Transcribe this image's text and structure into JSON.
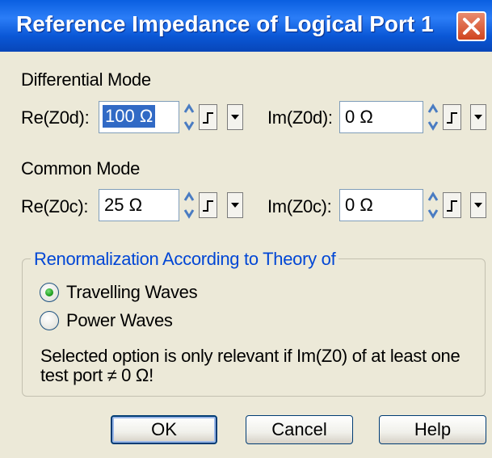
{
  "window": {
    "title": "Reference Impedance of Logical Port 1"
  },
  "differential": {
    "heading": "Differential Mode",
    "re_label": "Re(Z0d):",
    "re_value": "100 Ω",
    "im_label": "Im(Z0d):",
    "im_value": "0 Ω"
  },
  "common": {
    "heading": "Common Mode",
    "re_label": "Re(Z0c):",
    "re_value": "25 Ω",
    "im_label": "Im(Z0c):",
    "im_value": "0 Ω"
  },
  "renorm": {
    "title": "Renormalization According to Theory of",
    "options": [
      {
        "label": "Travelling Waves",
        "selected": true
      },
      {
        "label": "Power Waves",
        "selected": false
      }
    ],
    "note_line1": "Selected option is only relevant if Im(Z0) of at least one",
    "note_line2": "test port ≠ 0 Ω!"
  },
  "buttons": {
    "ok": "OK",
    "cancel": "Cancel",
    "help": "Help"
  },
  "icons": {
    "close": "close-icon",
    "spin": "spinner-arrows-icon",
    "step": "step-size-icon",
    "dropdown": "dropdown-arrow-icon"
  },
  "colors": {
    "titlebar": "#0a57d6",
    "group_title": "#0046d5",
    "selection": "#316ac5",
    "close_button": "#d0451f"
  }
}
